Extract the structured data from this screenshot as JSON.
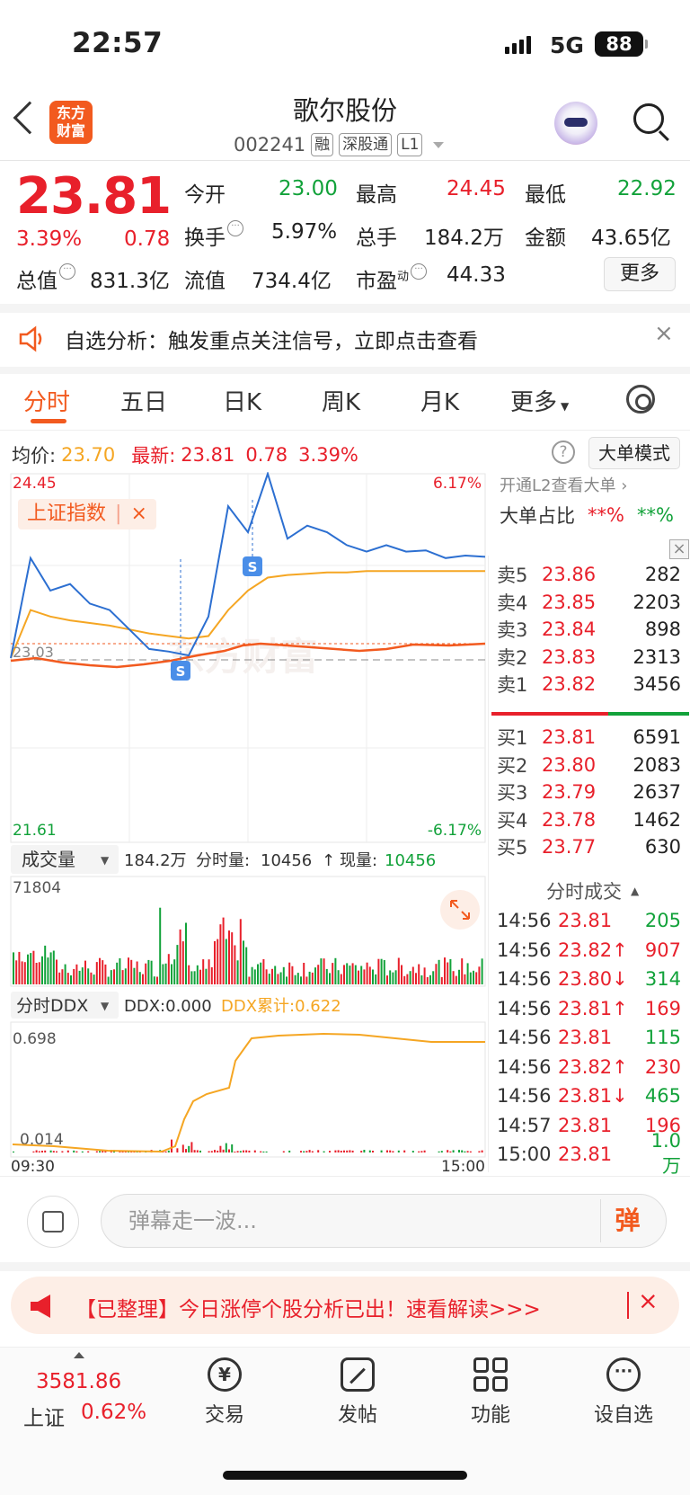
{
  "status": {
    "time": "22:57",
    "network": "5G",
    "battery": "88"
  },
  "header": {
    "logo": "东方财富",
    "title": "歌尔股份",
    "code": "002241",
    "tags": [
      "融",
      "深股通",
      "L1"
    ]
  },
  "quote": {
    "price": "23.81",
    "pct": "3.39%",
    "change": "0.78",
    "open_label": "今开",
    "open": "23.00",
    "high_label": "最高",
    "high": "24.45",
    "low_label": "最低",
    "low": "22.92",
    "turnover_label": "换手",
    "turnover": "5.97%",
    "volume_label": "总手",
    "volume": "184.2万",
    "amount_label": "金额",
    "amount": "43.65亿",
    "mktcap_label": "总值",
    "mktcap": "831.3亿",
    "float_label": "流值",
    "float": "734.4亿",
    "pe_label": "市盈",
    "pe_sup": "动",
    "pe": "44.33",
    "more": "更多"
  },
  "banner": {
    "text": "自选分析：触发重点关注信号，立即点击查看",
    "close": "×"
  },
  "tabs": [
    "分时",
    "五日",
    "日K",
    "周K",
    "月K",
    "更多"
  ],
  "avgrow": {
    "avg_label": "均价:",
    "avg": "23.70",
    "latest_label": "最新:",
    "latest": "23.81",
    "chg": "0.78",
    "pct": "3.39%",
    "help": "?",
    "mode": "大单模式"
  },
  "chart": {
    "y_max": "24.45",
    "y_min": "21.61",
    "y_base": "23.03",
    "pct_max": "6.17%",
    "pct_min": "-6.17%",
    "index_tag": "上证指数",
    "index_close": "×",
    "watermark": "东方财富",
    "b_mark": "S",
    "vol_label": "成交量",
    "vol_total": "184.2万",
    "vol_min_label": "分时量:",
    "vol_min": "10456",
    "vol_now_label": "现量:",
    "vol_now": "10456",
    "vol_max": "71804",
    "ddx_label": "分时DDX",
    "ddx": "DDX:0.000",
    "ddx_sum": "DDX累计:0.622",
    "ddx_max": "0.698",
    "ddx_min": "0.014",
    "t_start": "09:30",
    "t_end": "15:00"
  },
  "chart_data": {
    "type": "line",
    "title": "",
    "ylim": [
      21.61,
      24.45
    ],
    "x": [
      0,
      10,
      20,
      30,
      40,
      50,
      60,
      70,
      80,
      90,
      100,
      110,
      120,
      130,
      140,
      150,
      160,
      170,
      180,
      190,
      200,
      210,
      220,
      230,
      240
    ],
    "series": [
      {
        "values": [
          23.03,
          23.8,
          23.55,
          23.6,
          23.45,
          23.4,
          23.25,
          23.1,
          23.08,
          23.05,
          23.35,
          24.2,
          24.0,
          24.45,
          23.95,
          24.05,
          24.0,
          23.9,
          23.85,
          23.9,
          23.85,
          23.86,
          23.8,
          23.82,
          23.81
        ]
      },
      {
        "values": [
          23.03,
          23.4,
          23.35,
          23.32,
          23.3,
          23.28,
          23.25,
          23.22,
          23.2,
          23.18,
          23.2,
          23.4,
          23.55,
          23.65,
          23.67,
          23.68,
          23.69,
          23.69,
          23.7,
          23.7,
          23.7,
          23.7,
          23.7,
          23.7,
          23.7
        ]
      }
    ]
  },
  "l2": {
    "title": "大单占比",
    "a": "**%",
    "b": "**%",
    "top": "开通L2查看大单 ›"
  },
  "asks": [
    {
      "name": "卖5",
      "price": "23.86",
      "vol": "282"
    },
    {
      "name": "卖4",
      "price": "23.85",
      "vol": "2203"
    },
    {
      "name": "卖3",
      "price": "23.84",
      "vol": "898"
    },
    {
      "name": "卖2",
      "price": "23.83",
      "vol": "2313"
    },
    {
      "name": "卖1",
      "price": "23.82",
      "vol": "3456"
    }
  ],
  "bids": [
    {
      "name": "买1",
      "price": "23.81",
      "vol": "6591"
    },
    {
      "name": "买2",
      "price": "23.80",
      "vol": "2083"
    },
    {
      "name": "买3",
      "price": "23.79",
      "vol": "2637"
    },
    {
      "name": "买4",
      "price": "23.78",
      "vol": "1462"
    },
    {
      "name": "买5",
      "price": "23.77",
      "vol": "630"
    }
  ],
  "ticks_title": "分时成交",
  "ticks": [
    {
      "time": "14:56",
      "price": "23.81",
      "vol": "205",
      "color": "#12a23a"
    },
    {
      "time": "14:56",
      "price": "23.82↑",
      "vol": "907",
      "color": "#e8202b"
    },
    {
      "time": "14:56",
      "price": "23.80↓",
      "vol": "314",
      "color": "#12a23a"
    },
    {
      "time": "14:56",
      "price": "23.81↑",
      "vol": "169",
      "color": "#e8202b"
    },
    {
      "time": "14:56",
      "price": "23.81",
      "vol": "115",
      "color": "#12a23a"
    },
    {
      "time": "14:56",
      "price": "23.82↑",
      "vol": "230",
      "color": "#e8202b"
    },
    {
      "time": "14:56",
      "price": "23.81↓",
      "vol": "465",
      "color": "#12a23a"
    },
    {
      "time": "14:57",
      "price": "23.81",
      "vol": "196",
      "color": "#e8202b"
    },
    {
      "time": "15:00",
      "price": "23.81",
      "vol": "1.0万",
      "color": "#12a23a"
    }
  ],
  "danmu": {
    "placeholder": "弹幕走一波...",
    "btn": "弹"
  },
  "notice": {
    "text": "【已整理】今日涨停个股分析已出！速看解读>>>",
    "close": "×"
  },
  "bottom_nav": {
    "index_value": "3581.86",
    "index_name": "上证",
    "index_pct": "0.62%",
    "items": [
      "交易",
      "发帖",
      "功能",
      "设自选"
    ]
  },
  "colors": {
    "up": "#e8202b",
    "down": "#12a23a",
    "accent": "#f25a1f",
    "avg": "#f5a623"
  }
}
